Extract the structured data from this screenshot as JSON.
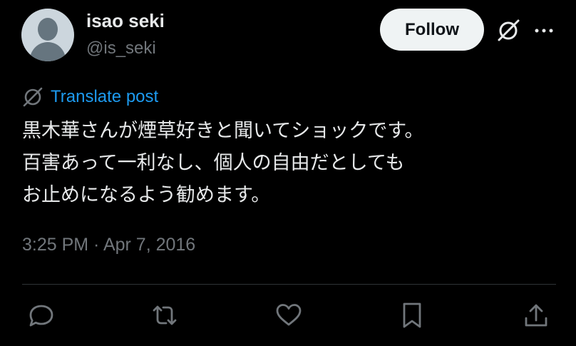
{
  "user": {
    "display_name": "isao seki",
    "handle": "@is_seki",
    "avatar_icon": "default-avatar-icon"
  },
  "header": {
    "follow_label": "Follow",
    "grok_icon": "grok-icon",
    "more_icon": "more-icon"
  },
  "translate": {
    "icon": "translate-icon",
    "label": "Translate post"
  },
  "post": {
    "lines": [
      "黒木華さんが煙草好きと聞いてショックです。",
      "百害あって一利なし、個人の自由だとしても",
      "お止めになるよう勧めます。"
    ],
    "timestamp": "3:25 PM · Apr 7, 2016"
  },
  "actions": {
    "icons": [
      "reply-icon",
      "repost-icon",
      "like-icon",
      "bookmark-icon",
      "share-icon"
    ]
  },
  "colors": {
    "background": "#000000",
    "text": "#e7e9ea",
    "secondary": "#71767b",
    "link": "#1d9bf0",
    "follow_button": "#eff3f4"
  }
}
